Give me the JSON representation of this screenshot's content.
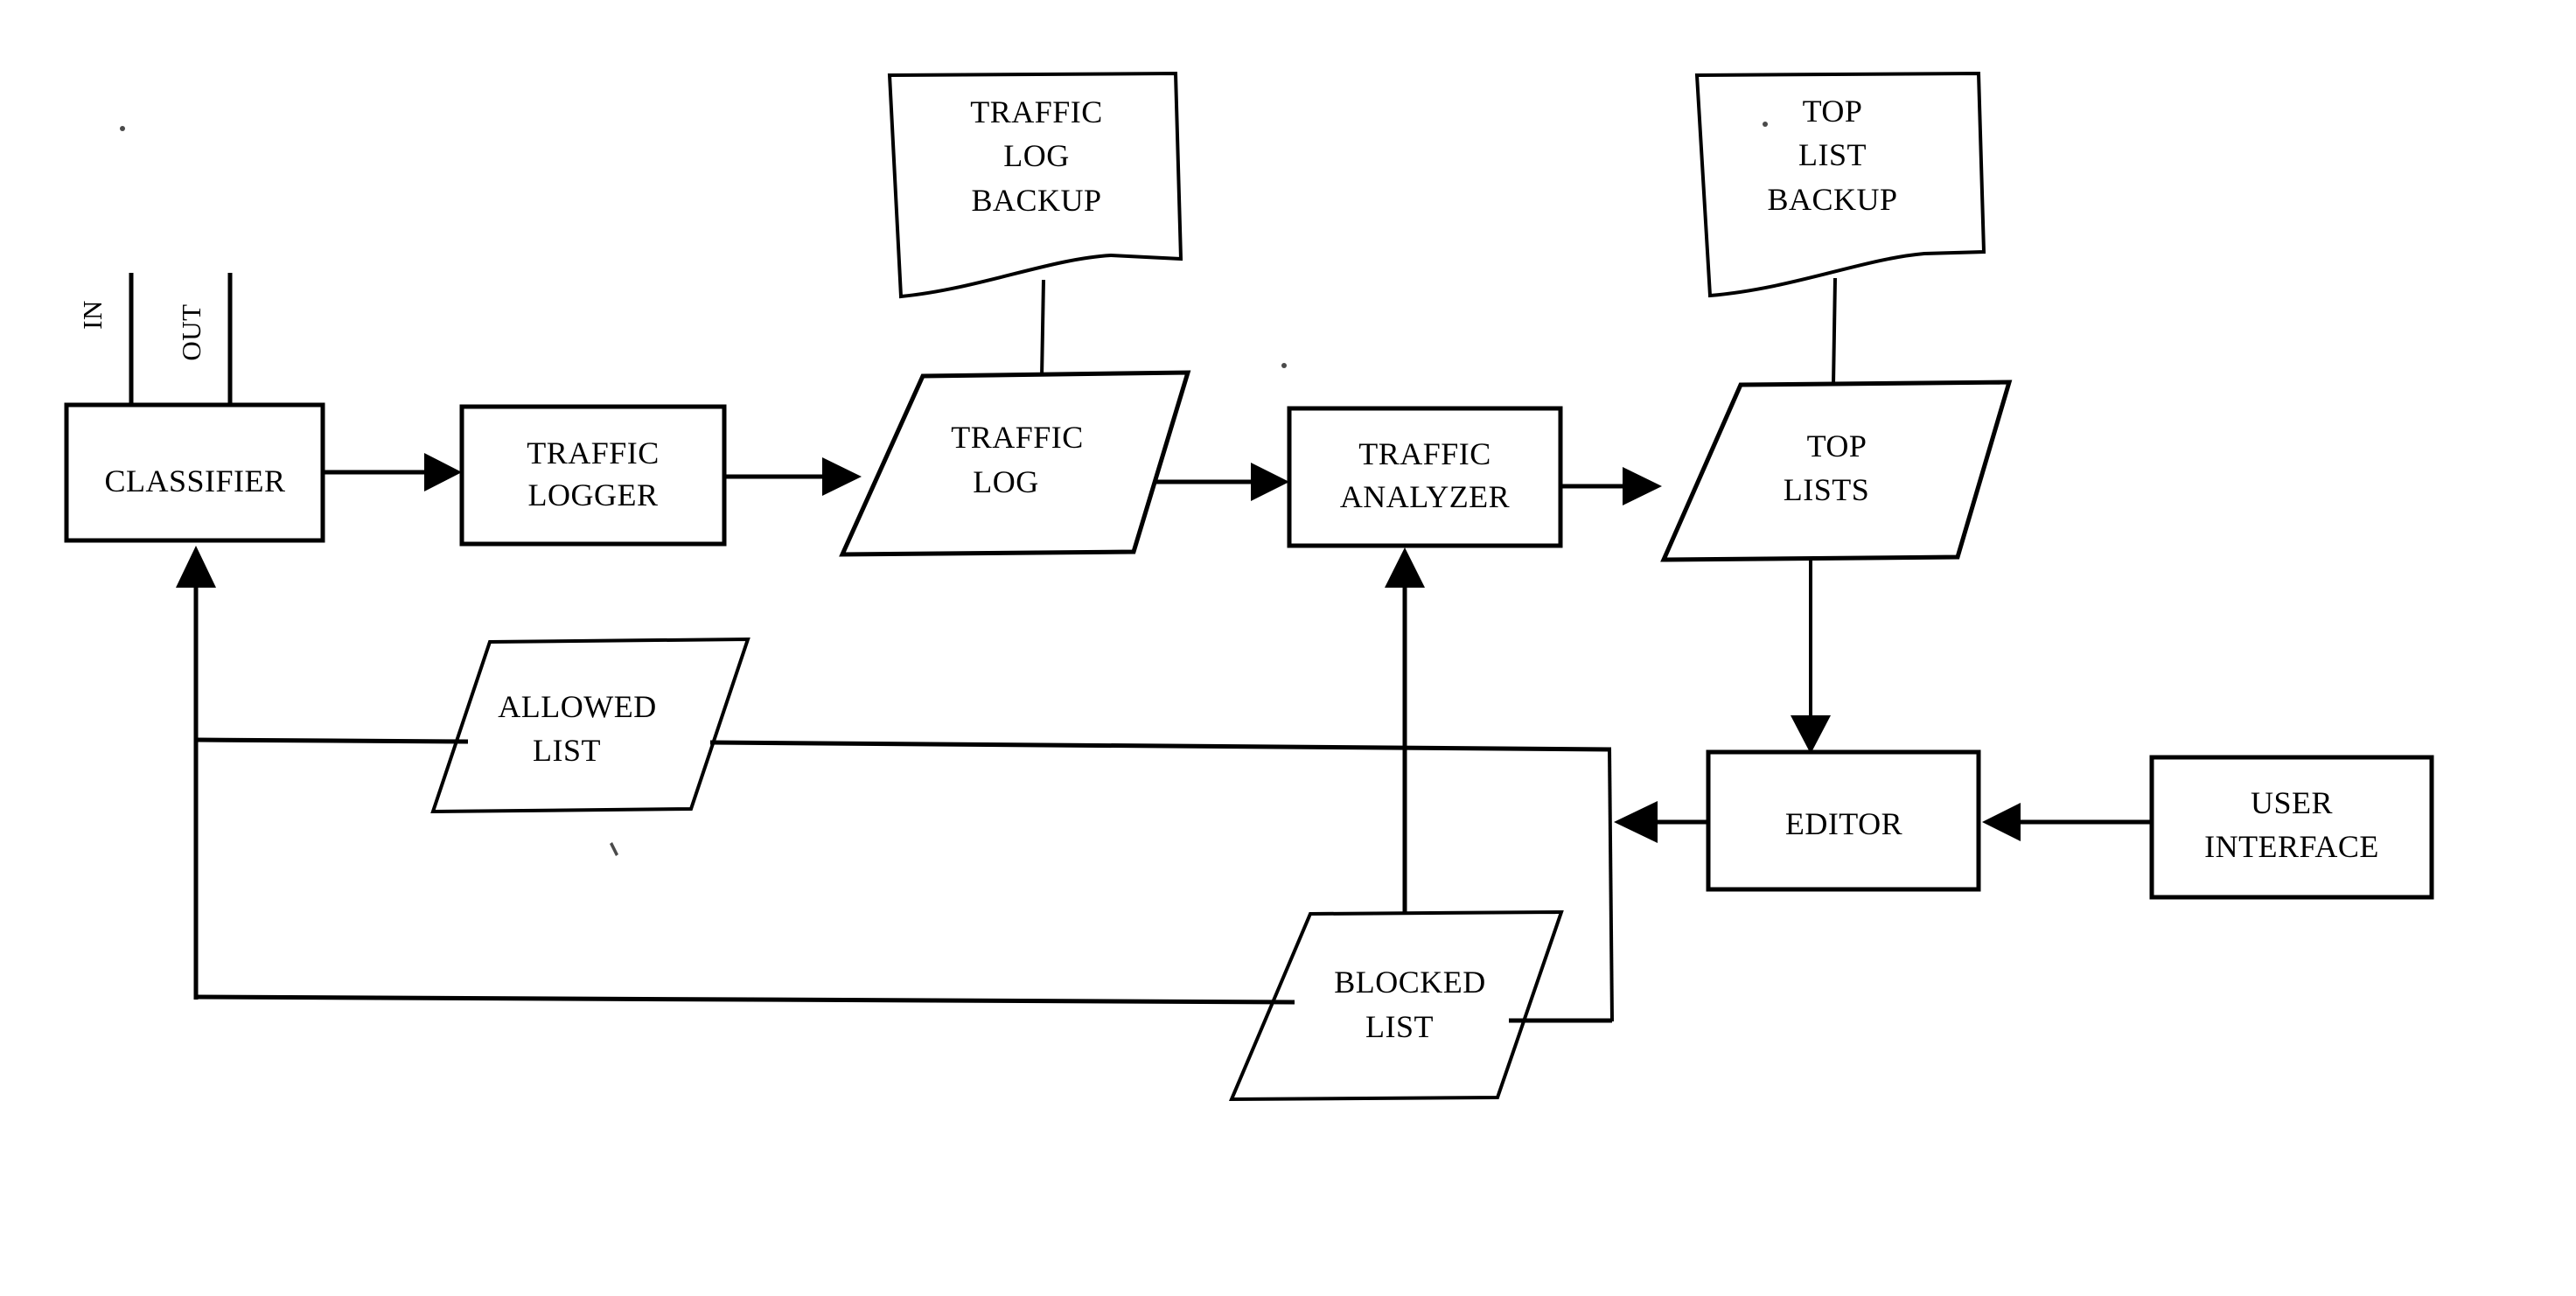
{
  "diagram": {
    "type": "block-flow-diagram",
    "background_color": "#ffffff",
    "line_color": "#000000",
    "io_labels": {
      "in": "IN",
      "out": "OUT"
    },
    "nodes": [
      {
        "id": "classifier",
        "shape": "rectangle",
        "lines": [
          "CLASSIFIER"
        ]
      },
      {
        "id": "traffic-logger",
        "shape": "rectangle",
        "lines": [
          "TRAFFIC",
          "LOGGER"
        ]
      },
      {
        "id": "traffic-log",
        "shape": "parallelogram",
        "lines": [
          "TRAFFIC",
          "LOG"
        ]
      },
      {
        "id": "traffic-log-backup",
        "shape": "document",
        "lines": [
          "TRAFFIC",
          "LOG",
          "BACKUP"
        ]
      },
      {
        "id": "traffic-analyzer",
        "shape": "rectangle",
        "lines": [
          "TRAFFIC",
          "ANALYZER"
        ]
      },
      {
        "id": "top-lists",
        "shape": "parallelogram",
        "lines": [
          "TOP",
          "LISTS"
        ]
      },
      {
        "id": "top-list-backup",
        "shape": "document",
        "lines": [
          "TOP",
          "LIST",
          "BACKUP"
        ]
      },
      {
        "id": "allowed-list",
        "shape": "parallelogram",
        "lines": [
          "ALLOWED",
          "LIST"
        ]
      },
      {
        "id": "blocked-list",
        "shape": "parallelogram",
        "lines": [
          "BLOCKED",
          "LIST"
        ]
      },
      {
        "id": "editor",
        "shape": "rectangle",
        "lines": [
          "EDITOR"
        ]
      },
      {
        "id": "user-interface",
        "shape": "rectangle",
        "lines": [
          "USER",
          "INTERFACE"
        ]
      }
    ],
    "edges": [
      {
        "from": "in",
        "to": "classifier",
        "arrow": false
      },
      {
        "from": "out",
        "to": "classifier",
        "arrow": false
      },
      {
        "from": "classifier",
        "to": "traffic-logger",
        "arrow": true
      },
      {
        "from": "traffic-logger",
        "to": "traffic-log",
        "arrow": true
      },
      {
        "from": "traffic-log-backup",
        "to": "traffic-log",
        "arrow": false
      },
      {
        "from": "traffic-log",
        "to": "traffic-analyzer",
        "arrow": true
      },
      {
        "from": "traffic-analyzer",
        "to": "top-lists",
        "arrow": true
      },
      {
        "from": "top-list-backup",
        "to": "top-lists",
        "arrow": false
      },
      {
        "from": "top-lists",
        "to": "editor",
        "arrow": true
      },
      {
        "from": "user-interface",
        "to": "editor",
        "arrow": true
      },
      {
        "from": "editor",
        "to": "lists-bus",
        "arrow": true
      },
      {
        "from": "allowed-list",
        "to": "classifier",
        "arrow": true
      },
      {
        "from": "blocked-list",
        "to": "classifier",
        "arrow": true
      },
      {
        "from": "blocked-list",
        "to": "traffic-analyzer",
        "arrow": true
      }
    ]
  },
  "labels": {
    "in": "IN",
    "out": "OUT",
    "classifier": "CLASSIFIER",
    "traffic_logger_1": "TRAFFIC",
    "traffic_logger_2": "LOGGER",
    "traffic_log_1": "TRAFFIC",
    "traffic_log_2": "LOG",
    "traffic_log_backup_1": "TRAFFIC",
    "traffic_log_backup_2": "LOG",
    "traffic_log_backup_3": "BACKUP",
    "traffic_analyzer_1": "TRAFFIC",
    "traffic_analyzer_2": "ANALYZER",
    "top_lists_1": "TOP",
    "top_lists_2": "LISTS",
    "top_list_backup_1": "TOP",
    "top_list_backup_2": "LIST",
    "top_list_backup_3": "BACKUP",
    "allowed_list_1": "ALLOWED",
    "allowed_list_2": "LIST",
    "blocked_list_1": "BLOCKED",
    "blocked_list_2": "LIST",
    "editor": "EDITOR",
    "user_interface_1": "USER",
    "user_interface_2": "INTERFACE"
  }
}
